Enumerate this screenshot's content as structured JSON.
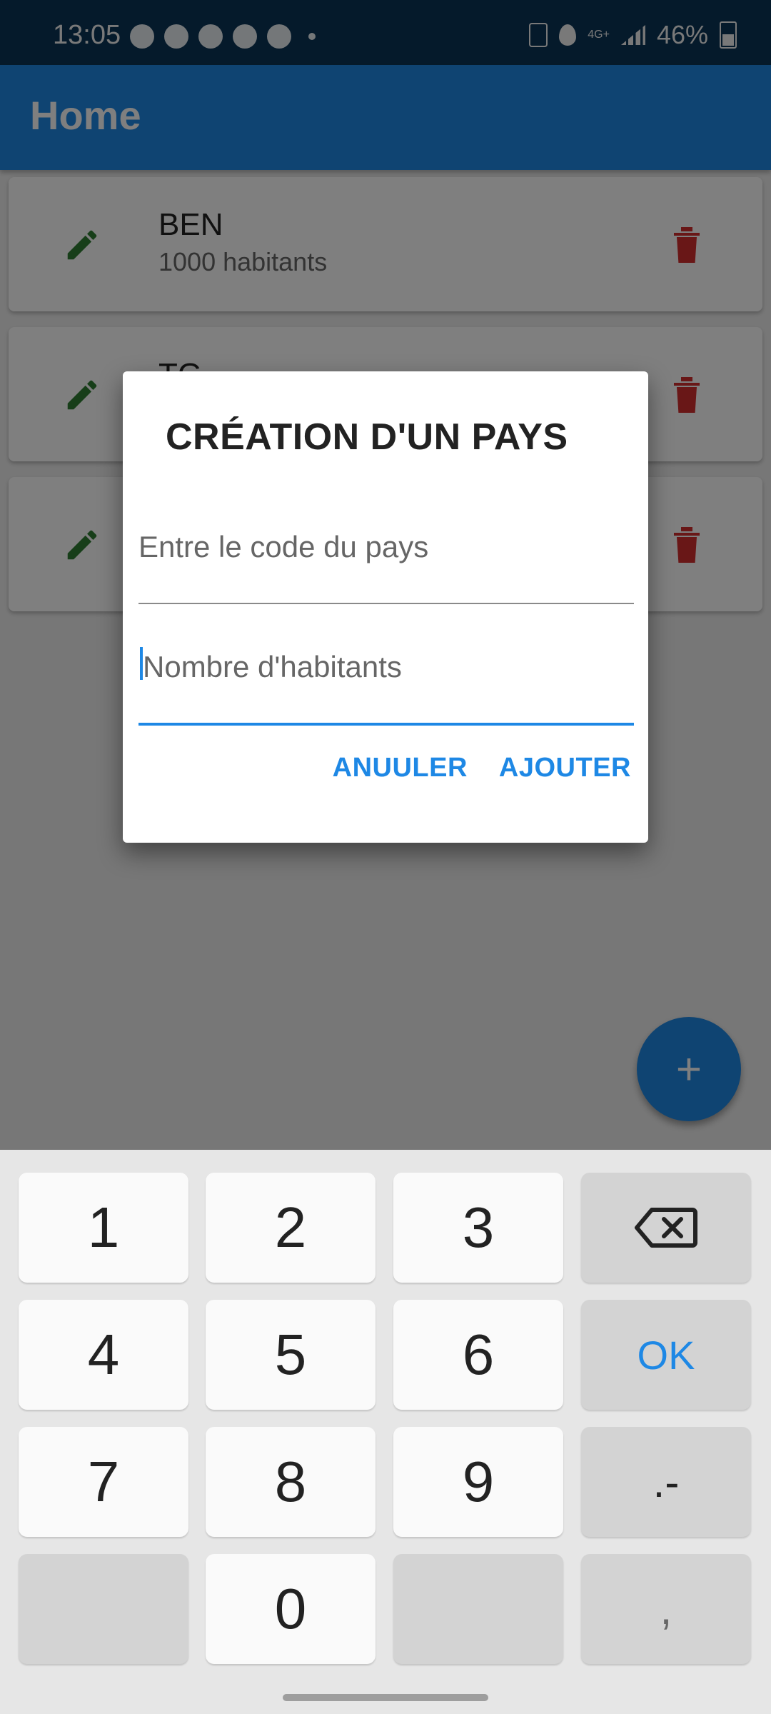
{
  "status_bar": {
    "time": "13:05",
    "network": "4G+",
    "battery": "46%",
    "left_icons": [
      "telegram-icon",
      "whatsapp-icon",
      "messenger-icon",
      "fingerprint-icon",
      "shazam-icon",
      "dot-icon"
    ]
  },
  "appbar": {
    "title": "Home"
  },
  "countries": [
    {
      "code": "BEN",
      "population": "1000 habitants"
    },
    {
      "code": "TG",
      "population": ""
    },
    {
      "code": "",
      "population": ""
    }
  ],
  "dialog": {
    "title": "CRÉATION D'UN PAYS",
    "code_placeholder": "Entre le code du pays",
    "population_placeholder": "Nombre d'habitants",
    "cancel_label": "ANUULER",
    "add_label": "AJOUTER"
  },
  "fab": {
    "label": "+"
  },
  "keyboard": {
    "keys": [
      "1",
      "2",
      "3",
      "4",
      "5",
      "6",
      "OK",
      "7",
      "8",
      "9",
      ".-",
      "0",
      ","
    ]
  },
  "colors": {
    "primary": "#1e88e5",
    "edit_icon": "#2e7d32",
    "delete_icon": "#d32f2f"
  }
}
